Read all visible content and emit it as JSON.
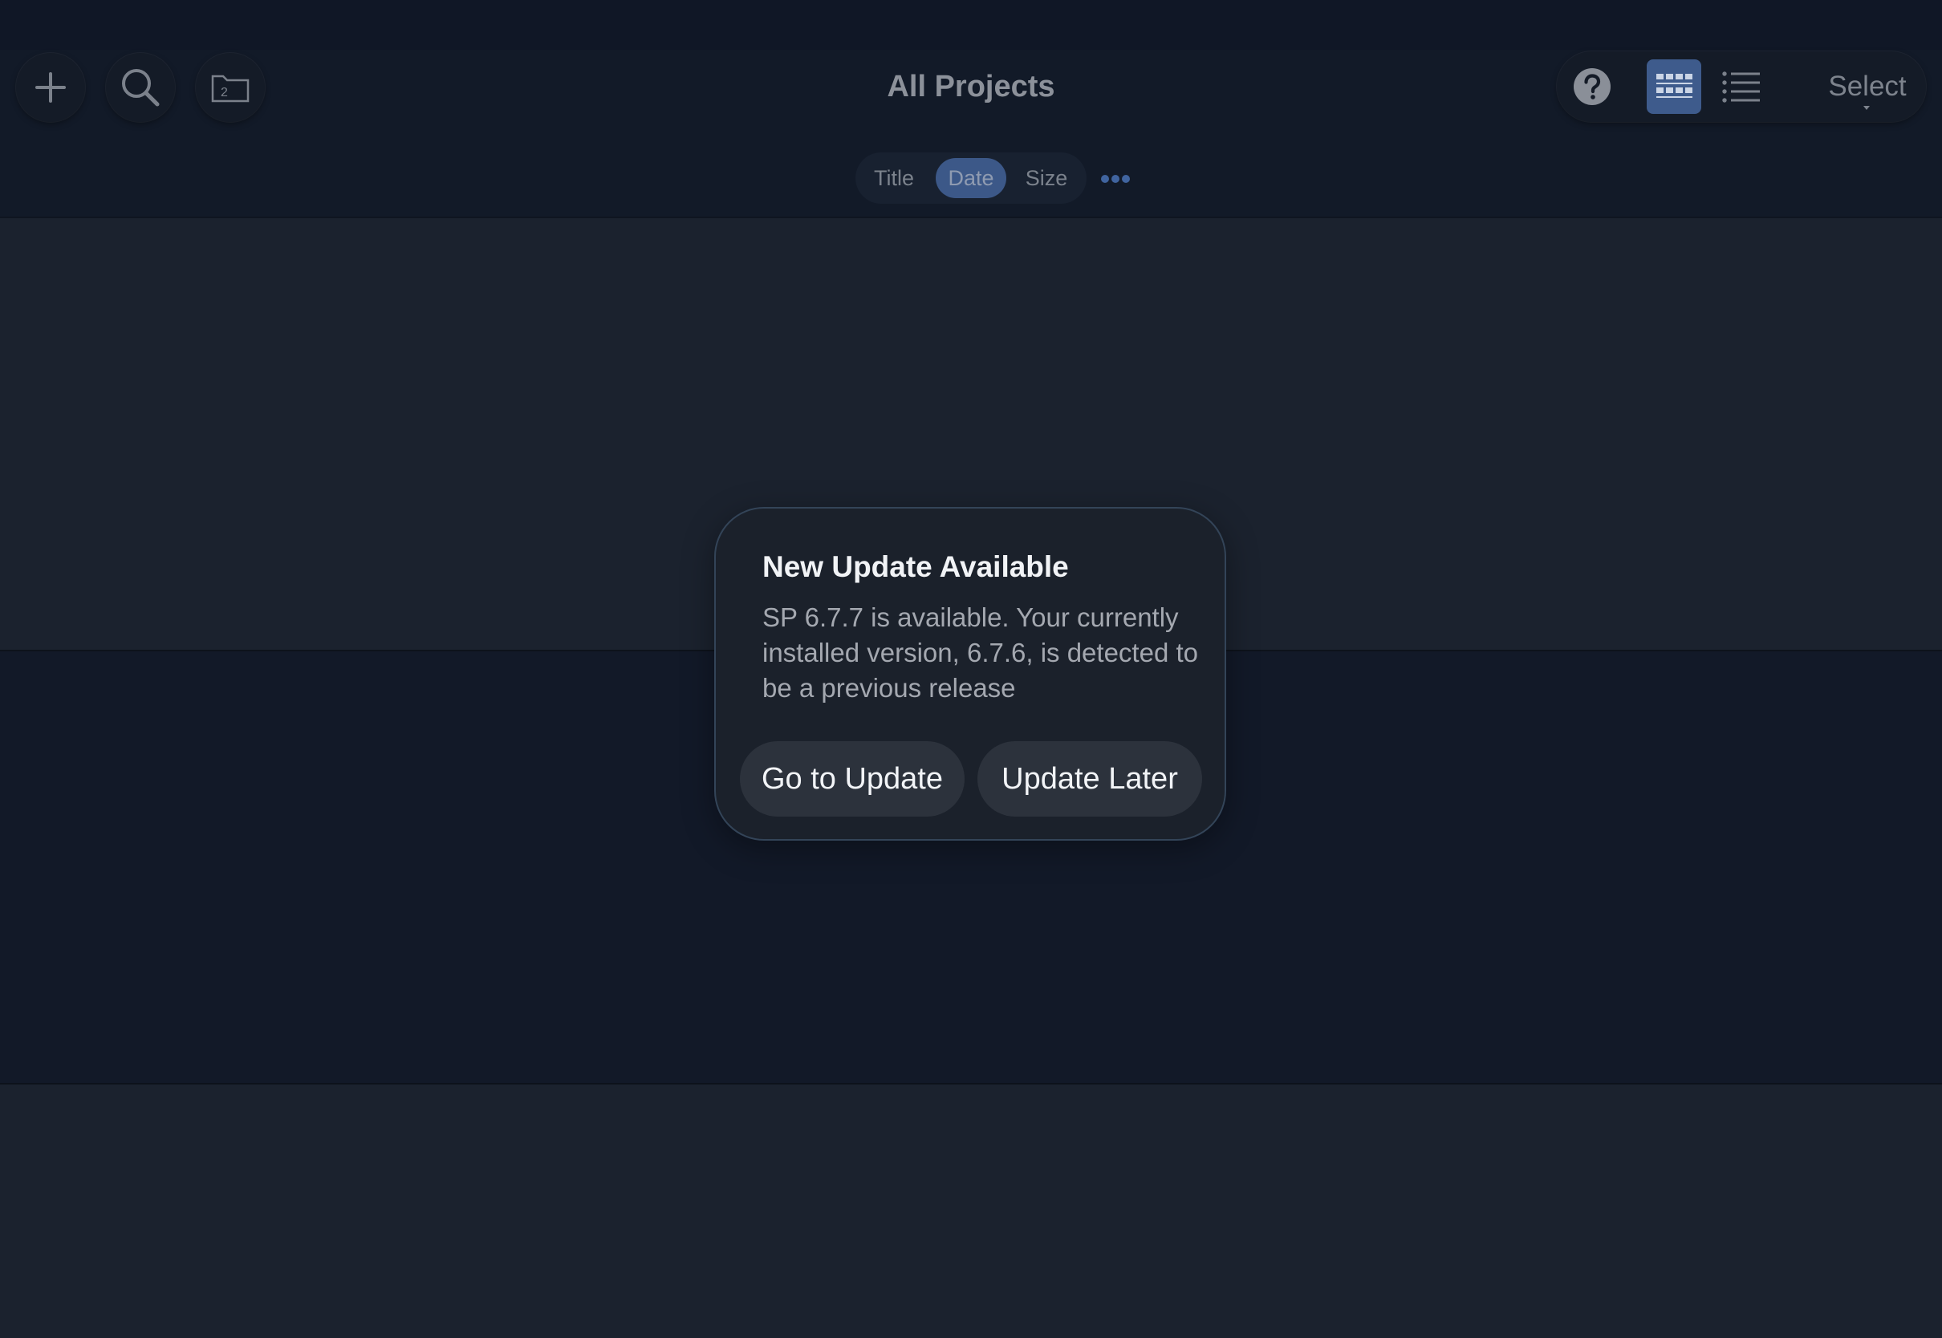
{
  "toolbar": {
    "title": "All Projects",
    "new_project_icon": "plus-icon",
    "search_icon": "search-icon",
    "folder_icon": "folder-icon",
    "folder_count": "2",
    "help_icon": "question-mark-icon",
    "grid_view_icon": "grid-view-icon",
    "list_view_icon": "list-view-icon",
    "select_label": "Select"
  },
  "sort": {
    "options": [
      {
        "label": "Title",
        "active": false
      },
      {
        "label": "Date",
        "active": true
      },
      {
        "label": "Size",
        "active": false
      }
    ],
    "more_icon": "ellipsis-icon"
  },
  "dialog": {
    "title": "New Update Available",
    "message": "SP 6.7.7 is available. Your currently installed version, 6.7.6, is detected to be a previous release",
    "primary_button": "Go to Update",
    "secondary_button": "Update Later"
  },
  "colors": {
    "accent_selected": "#3e5b8c",
    "dialog_border": "#334458",
    "background": "#1b222e"
  }
}
